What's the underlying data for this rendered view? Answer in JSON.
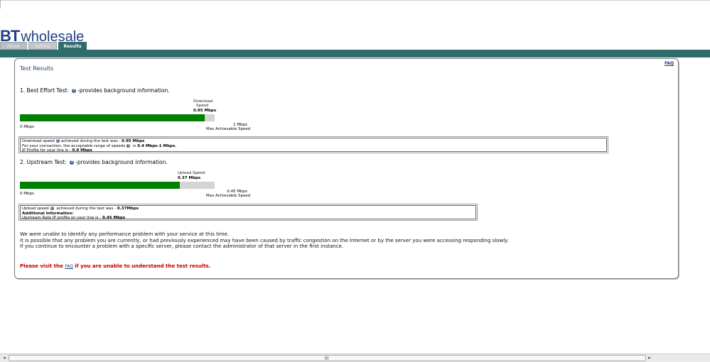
{
  "logo": {
    "bt": "BT",
    "wholesale": "wholesale"
  },
  "tabs": [
    {
      "label": "Home",
      "active": false
    },
    {
      "label": "Setting",
      "active": false
    },
    {
      "label": "Results",
      "active": true
    }
  ],
  "panel": {
    "title": "Test Results",
    "faq": "FAQ"
  },
  "best_effort": {
    "heading": "1. Best Effort Test:",
    "heading_suffix": "-provides background information.",
    "speed_label_line1": "Download",
    "speed_label_line2": "Speed",
    "speed_value": "0.95 Mbps",
    "fill_fraction": 0.95,
    "scale_min": "0 Mbps",
    "scale_max_line1": "1 Mbps",
    "scale_max_line2": "Max Achievable Speed",
    "box": {
      "l1_pre": "Download speed",
      "l1_mid": "achieved during the test was - ",
      "l1_val": "0.95 Mbps",
      "l2_pre": "For your connection, the acceptable range of speeds",
      "l2_mid": " is ",
      "l2_val": "0.4 Mbps-1 Mbps.",
      "l3_pre": "IP Profile for your line is - ",
      "l3_val": "0.9 Mbps"
    }
  },
  "upstream": {
    "heading": "2. Upstream Test:",
    "heading_suffix": "-provides background information.",
    "speed_label": "Upload Speed",
    "speed_value": "0.37 Mbps",
    "fill_fraction": 0.822,
    "scale_min": "0 Mbps",
    "scale_max_line1": "0.45 Mbps",
    "scale_max_line2": "Max Achievable Speed",
    "box": {
      "l1_pre": "Upload speed",
      "l1_mid": " achieved during the test was - ",
      "l1_val": "0.37Mbps",
      "l2": "Additional Information:",
      "l3_pre": "Upstream Rate IP profile on your line is - ",
      "l3_val": "0.45 Mbps"
    }
  },
  "messages": {
    "p1": "We were unable to identify any performance problem with your service at this time.",
    "p2": "It is possible that any problem you are currently, or had previously experienced may have been caused by traffic congestion on the Internet or by the server you were accessing responding slowly.",
    "p3": "If you continue to encounter a problem with a specific server, please contact the administrator of that server in the first instance.",
    "red_pre": "Please visit the ",
    "red_link": "FAQ",
    "red_post": " if you are unable to understand the test results."
  },
  "colors": {
    "brand": "#1f3f86",
    "band": "#2f6d6d",
    "bar_fill": "#008000",
    "bar_track": "#d4d4d4",
    "warning": "#c00000"
  }
}
